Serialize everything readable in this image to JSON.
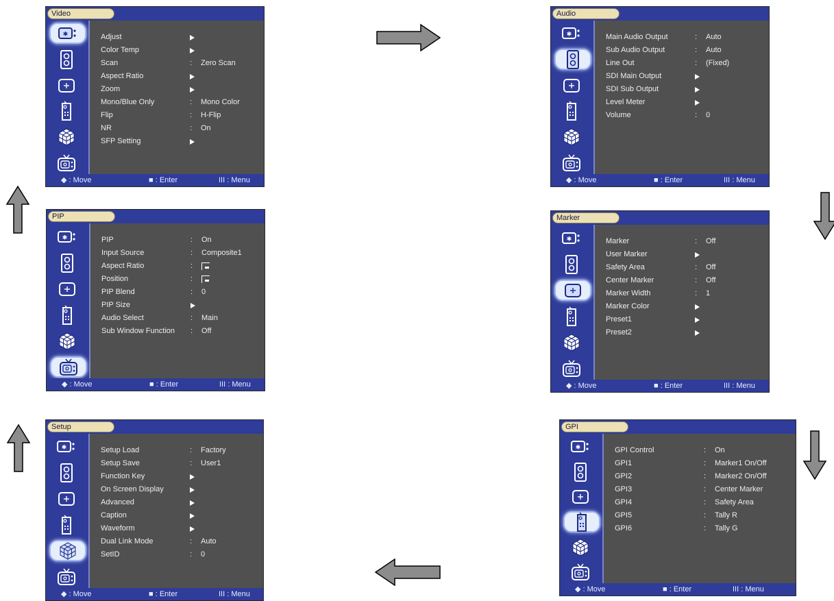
{
  "footer": {
    "move": "◆ : Move",
    "enter": "■ : Enter",
    "menu": "III : Menu"
  },
  "icons": [
    "picture-icon",
    "speaker-icon",
    "marker-icon",
    "remote-icon",
    "cube-icon",
    "tv-icon"
  ],
  "menus": {
    "video": {
      "title": "Video",
      "active_icon": 0,
      "items": [
        {
          "label": "Adjust",
          "type": "arrow"
        },
        {
          "label": "Color Temp",
          "type": "arrow"
        },
        {
          "label": "Scan",
          "type": "value",
          "value": "Zero Scan"
        },
        {
          "label": "Aspect Ratio",
          "type": "arrow"
        },
        {
          "label": "Zoom",
          "type": "arrow"
        },
        {
          "label": "Mono/Blue Only",
          "type": "value",
          "value": "Mono Color"
        },
        {
          "label": "Flip",
          "type": "value",
          "value": "H-Flip"
        },
        {
          "label": "NR",
          "type": "value",
          "value": "On"
        },
        {
          "label": "SFP Setting",
          "type": "arrow"
        }
      ]
    },
    "audio": {
      "title": "Audio",
      "active_icon": 1,
      "items": [
        {
          "label": "Main Audio Output",
          "type": "value",
          "value": "Auto"
        },
        {
          "label": "Sub Audio Output",
          "type": "value",
          "value": "Auto"
        },
        {
          "label": "Line Out",
          "type": "value",
          "value": "(Fixed)"
        },
        {
          "label": "SDI Main Output",
          "type": "arrow"
        },
        {
          "label": "SDI Sub Output",
          "type": "arrow"
        },
        {
          "label": "Level Meter",
          "type": "arrow"
        },
        {
          "label": "Volume",
          "type": "value",
          "value": "0"
        }
      ]
    },
    "pip": {
      "title": "PIP",
      "active_icon": 5,
      "items": [
        {
          "label": "PIP",
          "type": "value",
          "value": "On"
        },
        {
          "label": "Input Source",
          "type": "value",
          "value": "Composite1"
        },
        {
          "label": "Aspect Ratio",
          "type": "aspect"
        },
        {
          "label": "Position",
          "type": "aspect"
        },
        {
          "label": "PIP Blend",
          "type": "value",
          "value": "0"
        },
        {
          "label": "PIP Size",
          "type": "arrow"
        },
        {
          "label": "Audio Select",
          "type": "value",
          "value": "Main"
        },
        {
          "label": "Sub Window Function",
          "type": "value",
          "value": "Off"
        }
      ]
    },
    "marker": {
      "title": "Marker",
      "active_icon": 2,
      "items": [
        {
          "label": "Marker",
          "type": "value",
          "value": "Off"
        },
        {
          "label": "User Marker",
          "type": "arrow"
        },
        {
          "label": "Safety Area",
          "type": "value",
          "value": "Off"
        },
        {
          "label": "Center Marker",
          "type": "value",
          "value": "Off"
        },
        {
          "label": "Marker Width",
          "type": "value",
          "value": "1"
        },
        {
          "label": "Marker Color",
          "type": "arrow"
        },
        {
          "label": "Preset1",
          "type": "arrow"
        },
        {
          "label": "Preset2",
          "type": "arrow"
        }
      ]
    },
    "setup": {
      "title": "Setup",
      "active_icon": 4,
      "items": [
        {
          "label": "Setup Load",
          "type": "value",
          "value": "Factory"
        },
        {
          "label": "Setup Save",
          "type": "value",
          "value": "User1"
        },
        {
          "label": "Function Key",
          "type": "arrow"
        },
        {
          "label": "On Screen Display",
          "type": "arrow"
        },
        {
          "label": "Advanced",
          "type": "arrow"
        },
        {
          "label": "Caption",
          "type": "arrow"
        },
        {
          "label": "Waveform",
          "type": "arrow"
        },
        {
          "label": "Dual Link Mode",
          "type": "value",
          "value": "Auto"
        },
        {
          "label": "SetID",
          "type": "value",
          "value": "0"
        }
      ]
    },
    "gpi": {
      "title": "GPI",
      "active_icon": 3,
      "items": [
        {
          "label": "GPI Control",
          "type": "value",
          "value": "On"
        },
        {
          "label": "GPI1",
          "type": "value",
          "value": "Marker1 On/Off"
        },
        {
          "label": "GPI2",
          "type": "value",
          "value": "Marker2 On/Off"
        },
        {
          "label": "GPI3",
          "type": "value",
          "value": "Center Marker"
        },
        {
          "label": "GPI4",
          "type": "value",
          "value": "Safety Area"
        },
        {
          "label": "GPI5",
          "type": "value",
          "value": "Tally R"
        },
        {
          "label": "GPI6",
          "type": "value",
          "value": "Tally G"
        }
      ]
    }
  }
}
